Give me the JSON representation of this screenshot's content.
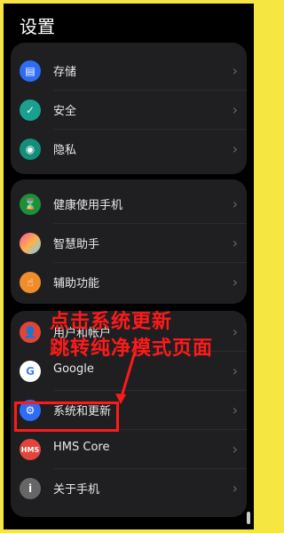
{
  "header": {
    "title": "设置"
  },
  "groups": [
    {
      "items": [
        {
          "label": "存储",
          "icon": "storage-icon"
        },
        {
          "label": "安全",
          "icon": "shield-icon"
        },
        {
          "label": "隐私",
          "icon": "privacy-icon"
        }
      ]
    },
    {
      "items": [
        {
          "label": "健康使用手机",
          "icon": "hourglass-icon"
        },
        {
          "label": "智慧助手",
          "icon": "assistant-icon"
        },
        {
          "label": "辅助功能",
          "icon": "accessibility-icon"
        }
      ]
    },
    {
      "items": [
        {
          "label": "用户和帐户",
          "icon": "user-icon"
        },
        {
          "label": "Google",
          "icon": "google-icon"
        },
        {
          "label": "系统和更新",
          "icon": "gear-icon"
        },
        {
          "label": "HMS Core",
          "icon": "hms-icon"
        },
        {
          "label": "关于手机",
          "icon": "info-icon"
        }
      ]
    }
  ],
  "annotation": {
    "line1": "点击系统更新",
    "line2": "跳转纯净模式页面",
    "color": "#ff1a1a"
  },
  "colors": {
    "background": "#000000",
    "frame": "#f5e642"
  }
}
